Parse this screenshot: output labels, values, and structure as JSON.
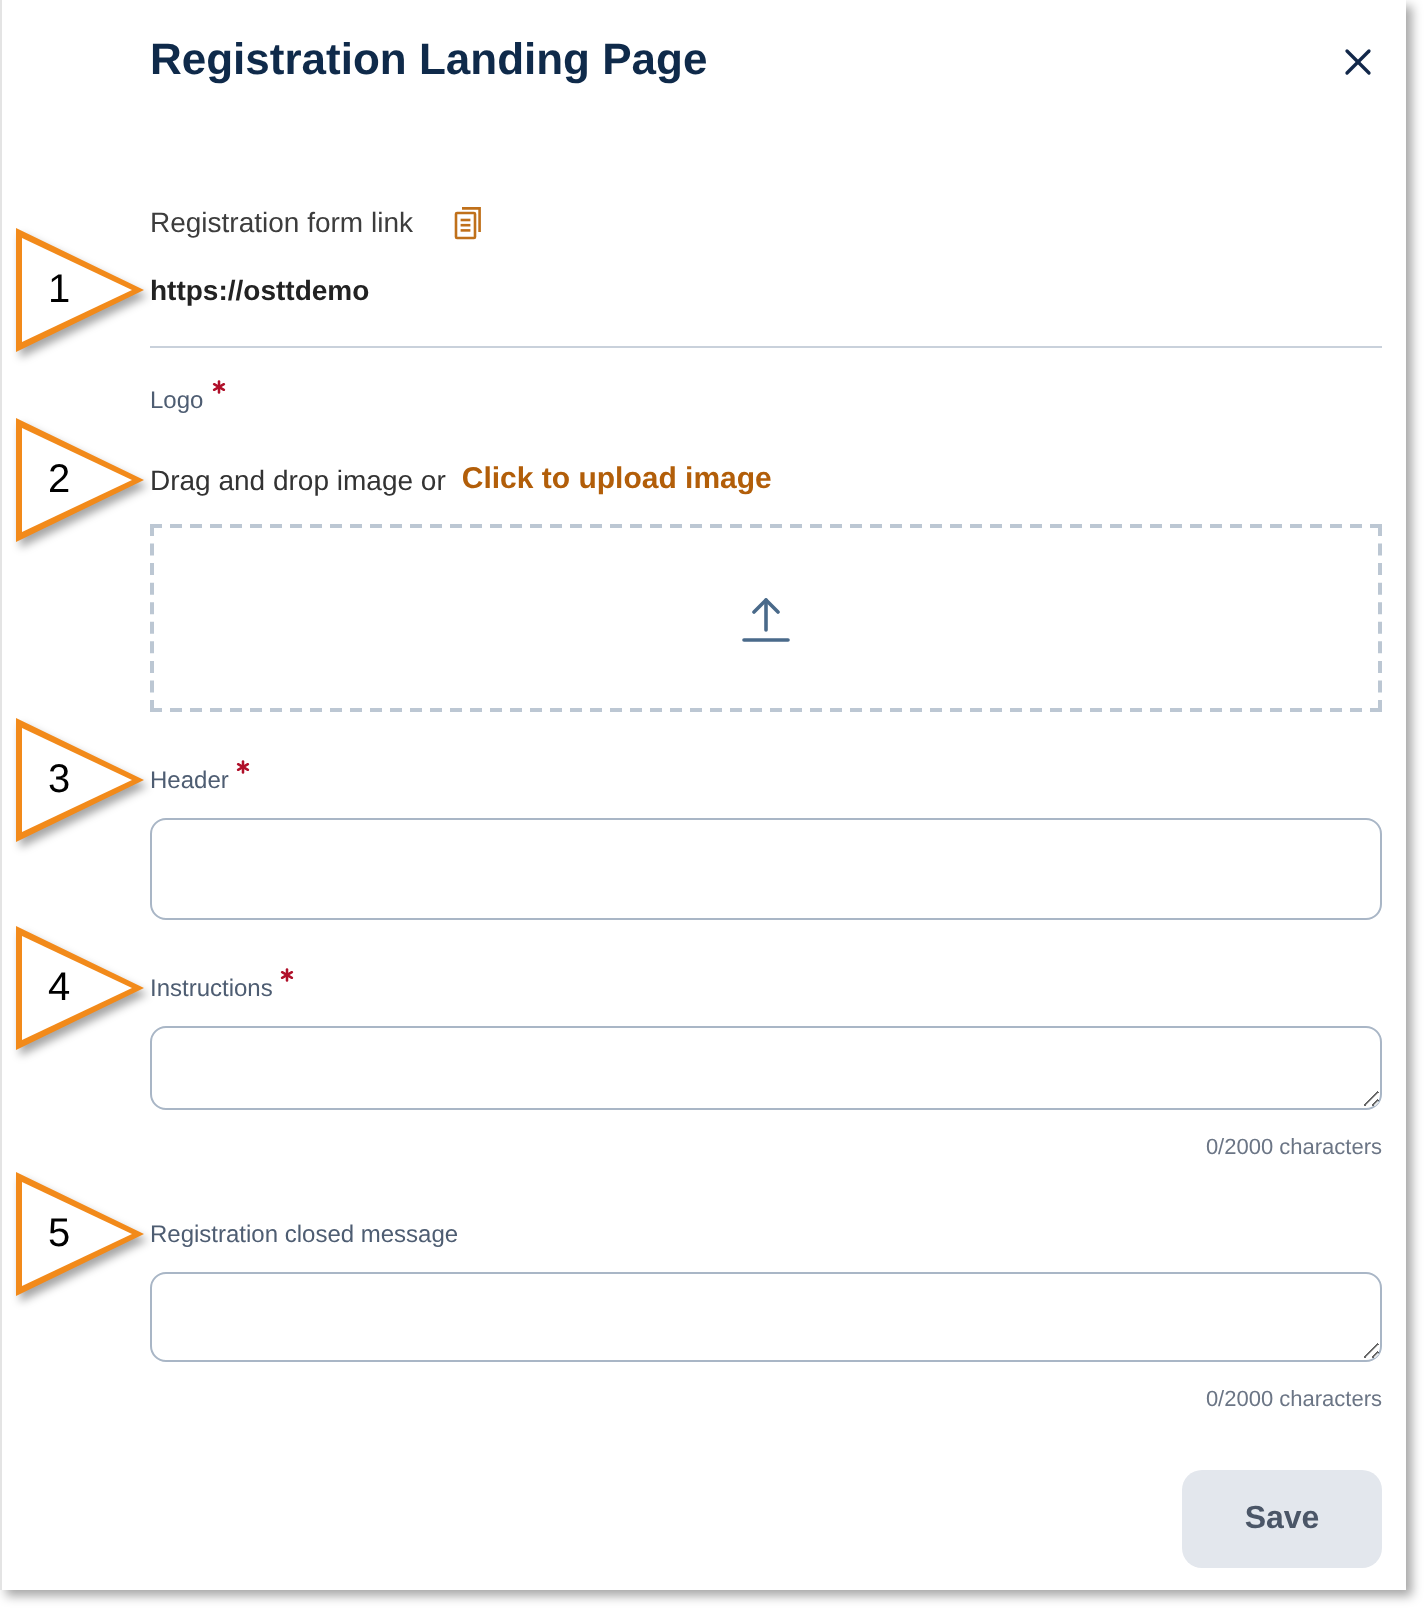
{
  "panel": {
    "title": "Registration Landing Page"
  },
  "form_link": {
    "label": "Registration form link",
    "value": "https://osttdemo",
    "callout": "1"
  },
  "logo": {
    "label": "Logo",
    "required": true,
    "hint": "Drag and drop image or",
    "upload_link": "Click to upload image",
    "callout": "2"
  },
  "fields": [
    {
      "kind": "input",
      "label": "Header",
      "required": true,
      "callout": "3"
    },
    {
      "kind": "textarea",
      "label": "Instructions",
      "required": true,
      "counter": "0/2000 characters",
      "callout": "4"
    },
    {
      "kind": "textarea",
      "label": "Registration closed message",
      "counter": "0/2000 characters",
      "callout": "5"
    }
  ],
  "save_button": {
    "label": "Save",
    "disabled": true
  }
}
